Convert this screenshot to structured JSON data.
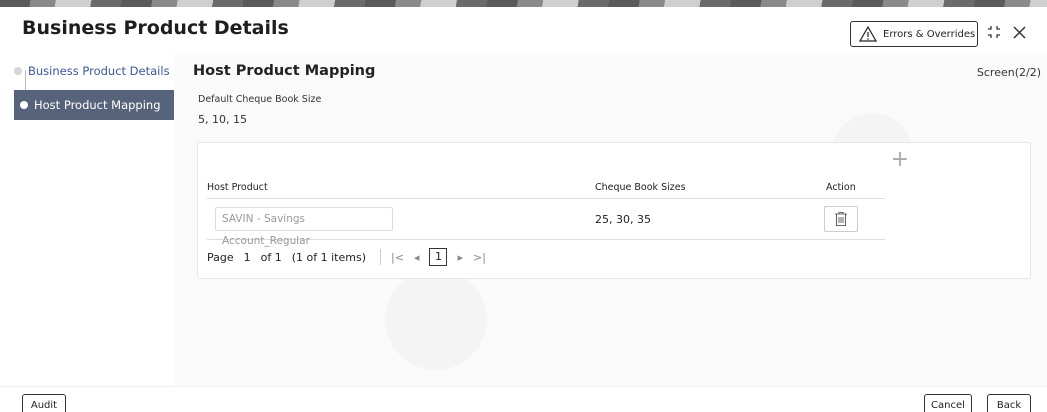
{
  "header": {
    "title": "Business Product Details",
    "errors_label": "Errors & Overrides"
  },
  "sidebar": {
    "items": [
      {
        "label": "Business Product Details",
        "state": "done"
      },
      {
        "label": "Host Product Mapping",
        "state": "active"
      }
    ]
  },
  "main": {
    "section_title": "Host Product Mapping",
    "screen_count": "Screen(2/2)",
    "cheque_book": {
      "label": "Default Cheque Book Size",
      "value": "5, 10, 15"
    },
    "grid": {
      "columns": [
        "Host Product",
        "Cheque Book Sizes",
        "Action"
      ],
      "rows": [
        {
          "host_product": "SAVIN - Savings Account_Regular",
          "sizes": "25, 30, 35"
        }
      ],
      "pager": {
        "page_label": "Page",
        "page": "1",
        "of_label": "of 1",
        "items_label": "(1 of 1 items)",
        "current_page": "1"
      }
    }
  },
  "footer": {
    "audit_label": "Audit",
    "cancel_label": "Cancel",
    "back_label": "Back"
  },
  "colors": {
    "active_nav_bg": "#57637a",
    "link_color": "#3b5998"
  }
}
